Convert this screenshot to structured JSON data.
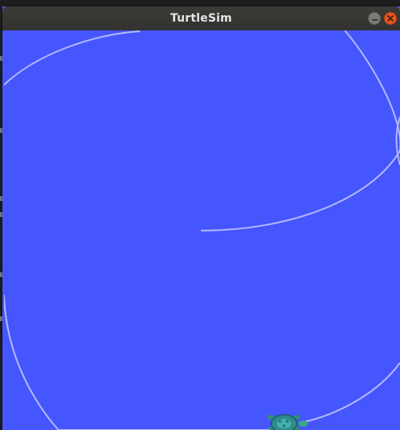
{
  "window": {
    "title": "TurtleSim"
  },
  "icons": {
    "minimize": "minimize-icon",
    "close": "close-icon",
    "turtle": "turtle-icon"
  },
  "colors": {
    "background": "#4556fe",
    "trail": "#b3b8ff",
    "titlebar": "#3c3b37",
    "close_button": "#e95420",
    "turtle_shell": "#2e8b8b"
  }
}
